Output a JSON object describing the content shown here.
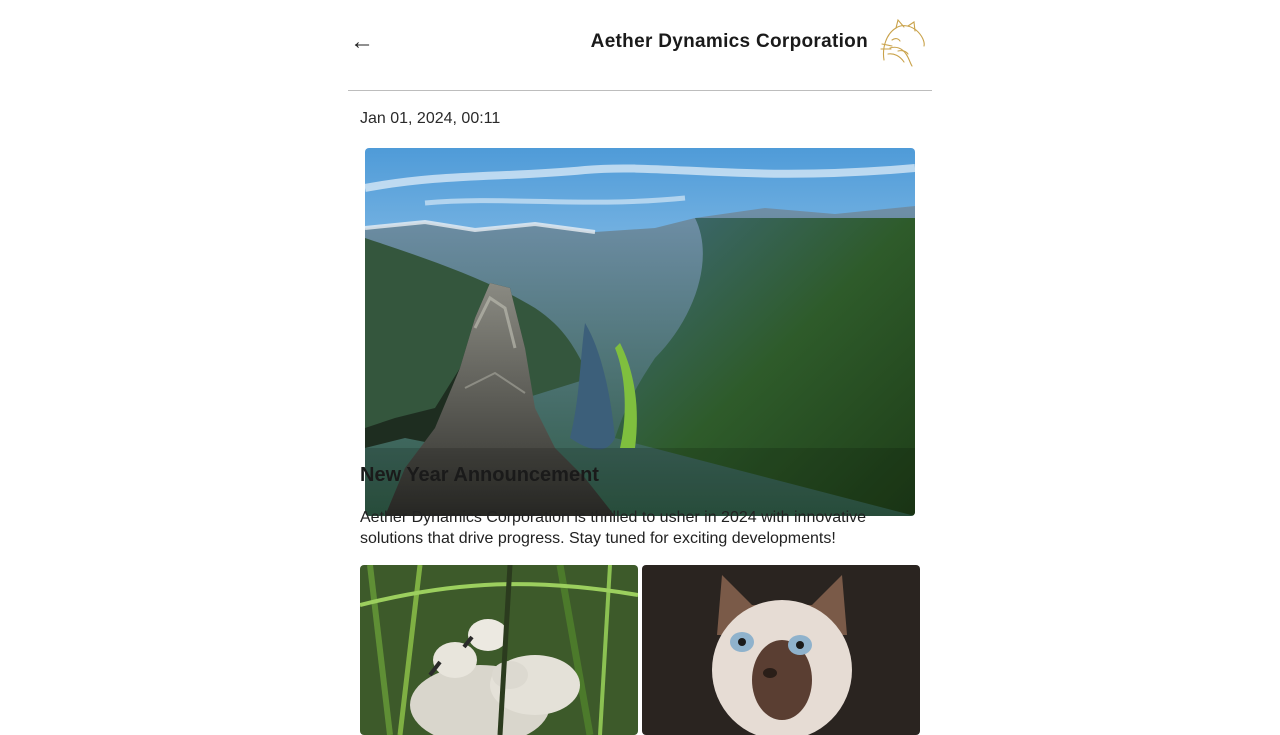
{
  "header": {
    "back_icon": "arrow-left-icon",
    "back_glyph": "←",
    "company_name": "Aether Dynamics Corporation",
    "logo_icon": "cat-line-logo"
  },
  "post": {
    "date": "Jan 01, 2024, 00:11",
    "title": "New Year Announcement",
    "body": "Aether Dynamics Corporation is thrilled to usher in 2024 with innovative solutions that drive progress. Stay tuned for exciting developments!",
    "hero_image": "fjord-mountain-landscape",
    "gallery": [
      "cygnets-in-grass",
      "siamese-kitten"
    ]
  },
  "colors": {
    "logo_gold": "#c9a24a",
    "divider": "#bdbdbd",
    "text": "#1a1a1a"
  }
}
